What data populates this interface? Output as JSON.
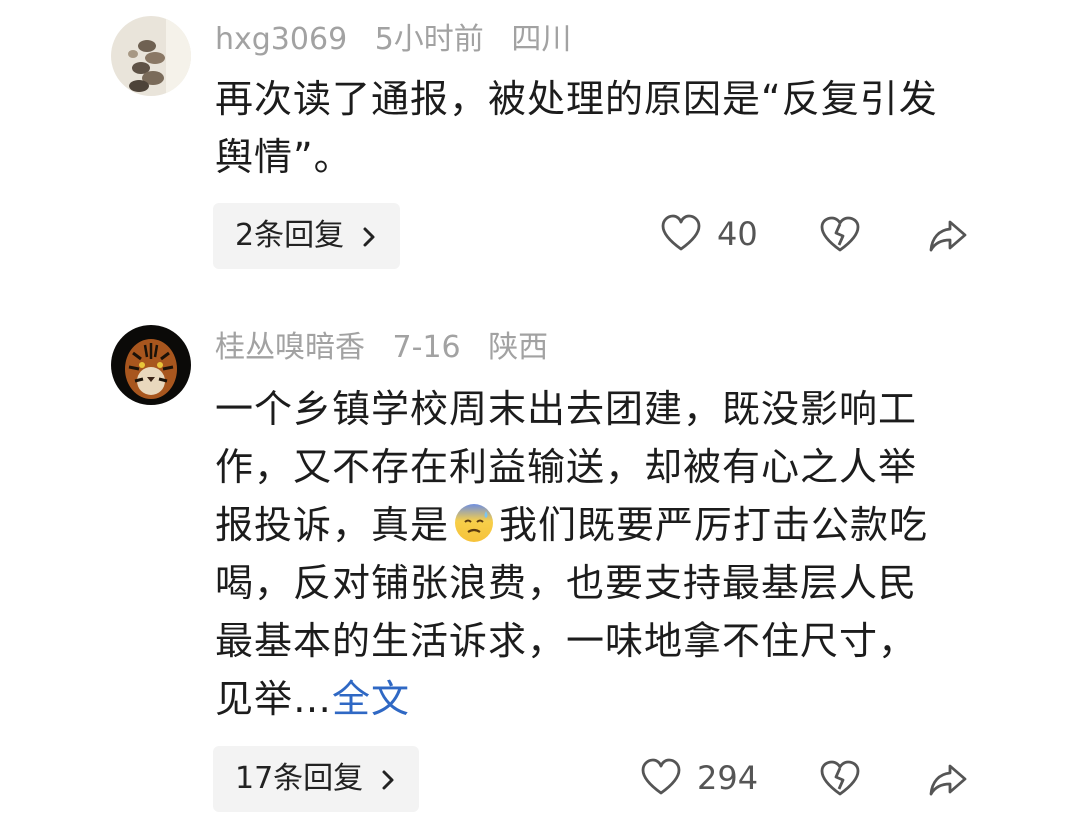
{
  "comments": [
    {
      "username": "hxg3069",
      "time": "5小时前",
      "location": "四川",
      "text_parts": [
        "再次读了通报，被处理的原因是“反复引发舆情”。"
      ],
      "replies_label": "2条回复",
      "likes": "40"
    },
    {
      "username": "桂丛嗅暗香",
      "time": "7-16",
      "location": "陕西",
      "text_before_emoji": "一个乡镇学校周末出去团建，既没影响工作，又不存在利益输送，却被有心之人举报投诉，真是",
      "text_after_emoji": "我们既要严厉打击公款吃喝，反对铺张浪费，也要支持最基层人民最基本的生活诉求，一味地拿不住尺寸，见举…",
      "full_text_label": "全文",
      "replies_label": "17条回复",
      "likes": "294"
    }
  ],
  "icons": {
    "like": "heart-outline-icon",
    "dislike": "broken-heart-icon",
    "share": "share-arrow-icon",
    "chevron": "chevron-right-icon",
    "emoji": "anxious-sweat-face-emoji"
  },
  "colors": {
    "meta": "#a2a2a2",
    "text": "#1c1c1c",
    "link": "#2f68c4",
    "reply_bg": "#f3f3f3"
  }
}
